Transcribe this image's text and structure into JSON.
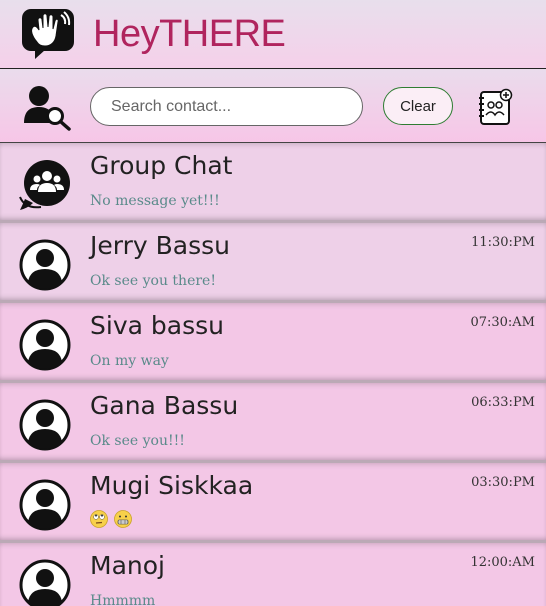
{
  "app": {
    "title": "HeyTHERE",
    "brand_color": "#b0245e"
  },
  "toolbar": {
    "search_placeholder": "Search contact...",
    "search_value": "",
    "clear_label": "Clear",
    "icons": [
      "user-search-icon",
      "contacts-book-icon"
    ]
  },
  "chats": [
    {
      "name": "Group Chat",
      "message": "No message yet!!!",
      "time": "",
      "avatar": "group-chat-icon"
    },
    {
      "name": "Jerry Bassu",
      "message": "Ok see you there!",
      "time": "11:30:PM",
      "avatar": "user-avatar-icon"
    },
    {
      "name": "Siva bassu",
      "message": "On my way",
      "time": "07:30:AM",
      "avatar": "user-avatar-icon"
    },
    {
      "name": "Gana Bassu",
      "message": "Ok see you!!!",
      "time": "06:33:PM",
      "avatar": "user-avatar-icon"
    },
    {
      "name": "Mugi Siskkaa",
      "message": "",
      "message_emojis": [
        "rolling-eyes-emoji",
        "grimace-emoji"
      ],
      "time": "03:30:PM",
      "avatar": "user-avatar-icon"
    },
    {
      "name": "Manoj",
      "message": "Hmmmm",
      "time": "12:00:AM",
      "avatar": "user-avatar-icon"
    }
  ]
}
